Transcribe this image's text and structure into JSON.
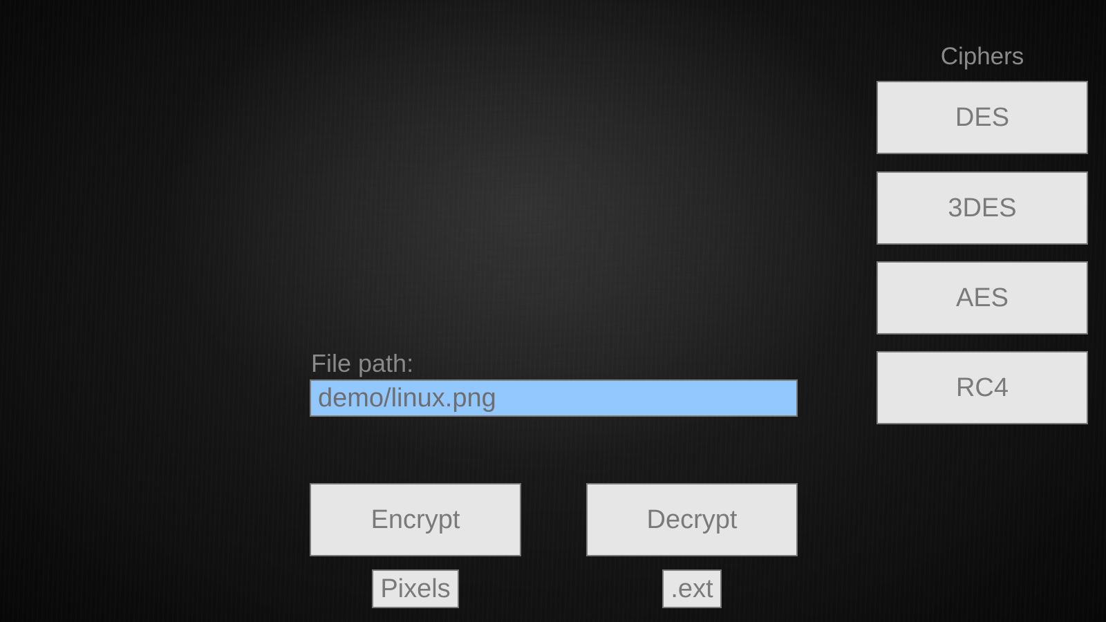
{
  "ciphers": {
    "heading": "Ciphers",
    "items": [
      {
        "label": "DES"
      },
      {
        "label": "3DES"
      },
      {
        "label": "AES"
      },
      {
        "label": "RC4"
      }
    ]
  },
  "file": {
    "label": "File path:",
    "value": "demo/linux.png"
  },
  "actions": {
    "encrypt_label": "Encrypt",
    "decrypt_label": "Decrypt",
    "pixels_label": "Pixels",
    "ext_label": ".ext"
  },
  "colors": {
    "button_bg": "#e6e6e6",
    "button_text": "#7a7a7a",
    "input_bg": "#93c8ff"
  }
}
